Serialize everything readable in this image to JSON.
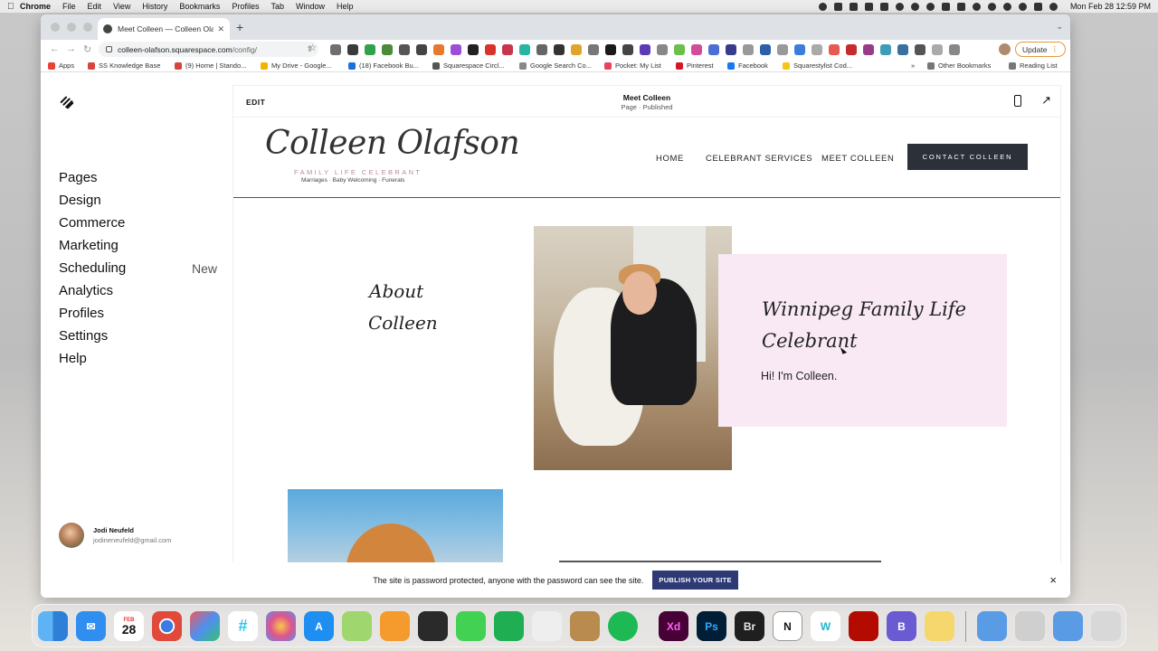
{
  "menubar": {
    "app": "Chrome",
    "items": [
      "File",
      "Edit",
      "View",
      "History",
      "Bookmarks",
      "Profiles",
      "Tab",
      "Window",
      "Help"
    ],
    "clock": "Mon Feb 28  12:59 PM"
  },
  "browser": {
    "tab_title": "Meet Colleen — Colleen Olafso",
    "url_domain": "colleen-olafson.squarespace.com",
    "url_path": "/config/",
    "update_label": "Update",
    "bookmarks": [
      "Apps",
      "SS Knowledge Base",
      "(9) Home | Stando...",
      "My Drive - Google...",
      "(18) Facebook Bu...",
      "Squarespace Circl...",
      "Google Search Co...",
      "Pocket: My List",
      "Pinterest",
      "Facebook",
      "Squarestylist Cod..."
    ],
    "bookmarks_more": "»",
    "other_bookmarks": "Other Bookmarks",
    "reading_list": "Reading List"
  },
  "sidebar": {
    "items": [
      {
        "label": "Pages",
        "badge": ""
      },
      {
        "label": "Design",
        "badge": ""
      },
      {
        "label": "Commerce",
        "badge": ""
      },
      {
        "label": "Marketing",
        "badge": ""
      },
      {
        "label": "Scheduling",
        "badge": "New"
      },
      {
        "label": "Analytics",
        "badge": ""
      },
      {
        "label": "Profiles",
        "badge": ""
      },
      {
        "label": "Settings",
        "badge": ""
      },
      {
        "label": "Help",
        "badge": ""
      }
    ],
    "user_name": "Jodi Neufeld",
    "user_email": "jodineneufeld@gmail.com"
  },
  "preview": {
    "edit_label": "EDIT",
    "page_title": "Meet Colleen",
    "page_status": "Page · Published",
    "site": {
      "logo": "Colleen Olafson",
      "logo_sub": "FAMILY LIFE CELEBRANT",
      "logo_tagline": "Marriages · Baby Welcoming · Funerals",
      "nav": [
        "HOME",
        "CELEBRANT SERVICES",
        "MEET COLLEEN"
      ],
      "contact_button": "CONTACT COLLEEN",
      "about_heading_line1": "About",
      "about_heading_line2": "Colleen",
      "card_title_line1": "Winnipeg Family Life",
      "card_title_line2": "Celebrant",
      "card_text": "Hi! I'm Colleen."
    }
  },
  "password_bar": {
    "text": "The site is password protected, anyone with the password can see the site.",
    "publish_button": "PUBLISH YOUR SITE",
    "close": "×"
  },
  "dock": {
    "calendar_month": "FEB",
    "calendar_day": "28",
    "labeled_apps": {
      "xd": "Xd",
      "ps": "Ps",
      "br": "Br",
      "notion": "N",
      "w": "W",
      "b": "B"
    }
  }
}
